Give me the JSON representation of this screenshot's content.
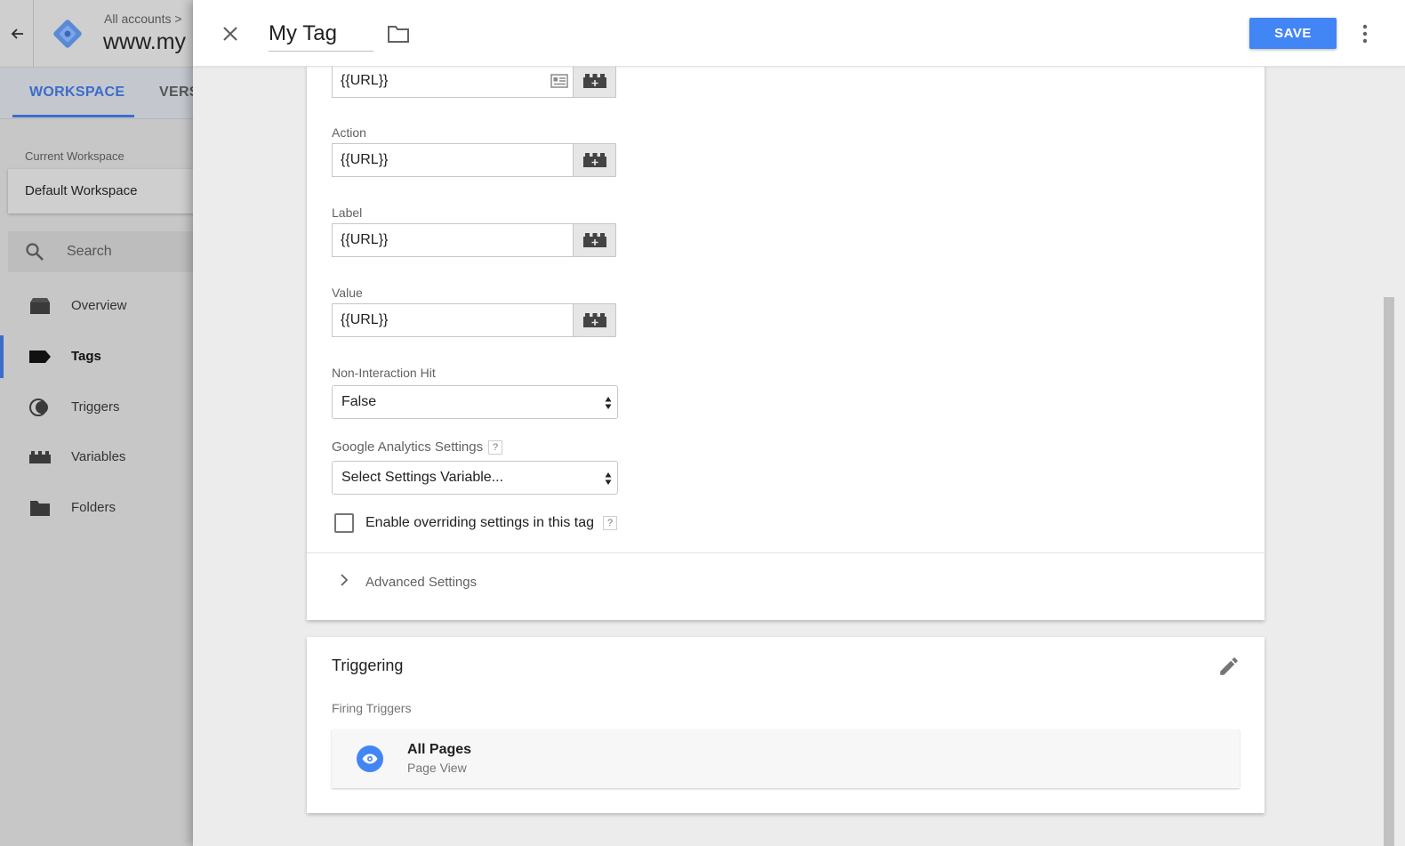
{
  "background": {
    "breadcrumb": "All accounts  >",
    "container_name": "www.my",
    "tabs": {
      "workspace": "WORKSPACE",
      "versions": "VERS"
    },
    "current_workspace_label": "Current Workspace",
    "workspace_name": "Default Workspace",
    "search_placeholder": "Search",
    "nav": [
      {
        "label": "Overview",
        "icon": "overview-icon"
      },
      {
        "label": "Tags",
        "icon": "tag-icon",
        "active": true
      },
      {
        "label": "Triggers",
        "icon": "trigger-icon"
      },
      {
        "label": "Variables",
        "icon": "variables-icon"
      },
      {
        "label": "Folders",
        "icon": "folder-icon"
      }
    ]
  },
  "header": {
    "tag_name": "My Tag",
    "save_label": "SAVE"
  },
  "config": {
    "category_value": "{{URL}}",
    "fields": [
      {
        "label": "Action",
        "value": "{{URL}}"
      },
      {
        "label": "Label",
        "value": "{{URL}}"
      },
      {
        "label": "Value",
        "value": "{{URL}}"
      }
    ],
    "non_interaction": {
      "label": "Non-Interaction Hit",
      "selected": "False"
    },
    "ga_settings": {
      "label": "Google Analytics Settings",
      "help": "?",
      "selected": "Select Settings Variable..."
    },
    "override": {
      "label": "Enable overriding settings in this tag",
      "help": "?",
      "checked": false
    },
    "advanced_label": "Advanced Settings"
  },
  "triggering": {
    "title": "Triggering",
    "firing_label": "Firing Triggers",
    "trigger": {
      "name": "All Pages",
      "type": "Page View"
    }
  },
  "colors": {
    "accent": "#4285f4",
    "workspace_tab": "#3a6dc9"
  }
}
